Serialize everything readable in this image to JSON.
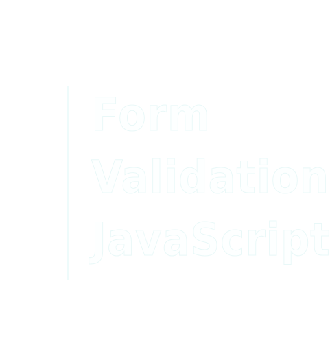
{
  "logo": {
    "lines": [
      "Form",
      "Validation",
      "JavaScript"
    ],
    "colors": {
      "background": "#ffffff",
      "text_fill": "#fdffff",
      "text_outline": "#e9f8f8",
      "accent_bar": "#eefbfb"
    }
  }
}
